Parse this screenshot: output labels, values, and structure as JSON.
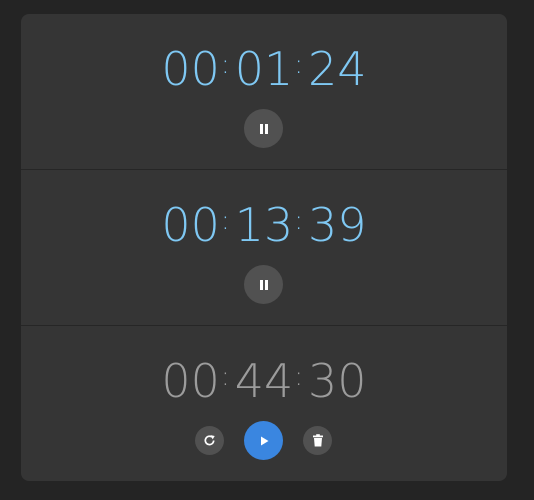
{
  "timers": [
    {
      "hours": "00",
      "minutes": "01",
      "seconds": "24",
      "separator": ":",
      "state": "running",
      "color": "#7fc8f3",
      "controls": [
        {
          "icon": "pause-icon"
        }
      ]
    },
    {
      "hours": "00",
      "minutes": "13",
      "seconds": "39",
      "separator": ":",
      "state": "running",
      "color": "#7fc8f3",
      "controls": [
        {
          "icon": "pause-icon"
        }
      ]
    },
    {
      "hours": "00",
      "minutes": "44",
      "seconds": "30",
      "separator": ":",
      "state": "paused",
      "color": "#9c9c9c",
      "controls": [
        {
          "icon": "reset-icon"
        },
        {
          "icon": "play-icon",
          "accent": "#3a86e0"
        },
        {
          "icon": "trash-icon"
        }
      ]
    }
  ]
}
